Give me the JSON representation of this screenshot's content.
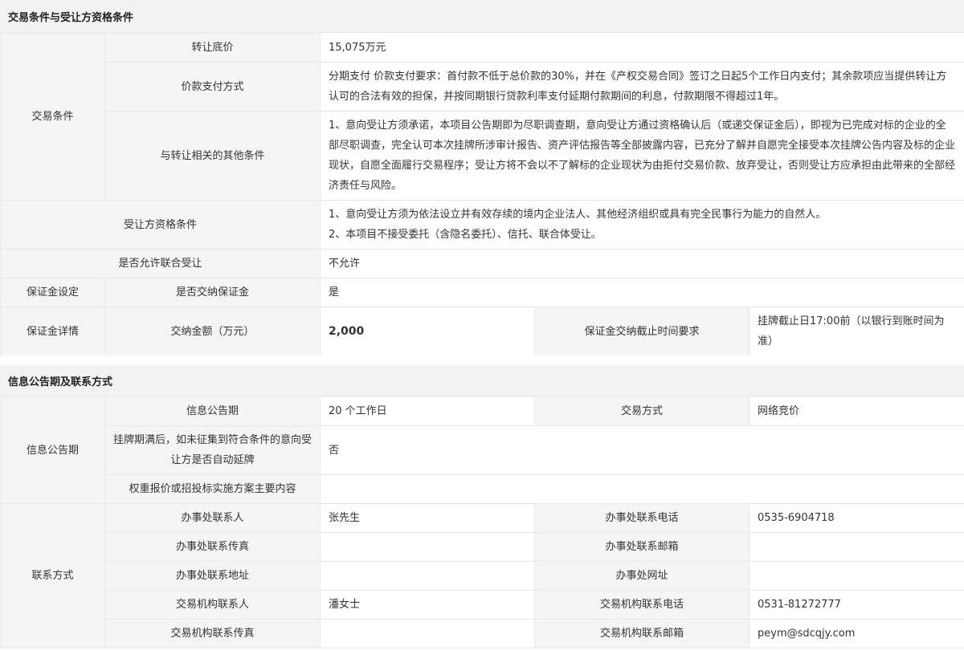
{
  "section1": {
    "title": "交易条件与受让方资格条件",
    "trade_conditions_label": "交易条件",
    "transfer_price_label": "转让底价",
    "transfer_price_value": "15,075万元",
    "payment_method_label": "价款支付方式",
    "payment_method_value": "分期支付 价款支付要求：首付款不低于总价款的30%，并在《产权交易合同》签订之日起5个工作日内支付；其余款项应当提供转让方认可的合法有效的担保，并按同期银行贷款利率支付延期付款期间的利息，付款期限不得超过1年。",
    "other_conditions_label": "与转让相关的其他条件",
    "other_conditions_value": "1、意向受让方须承诺，本项目公告期即为尽职调查期，意向受让方通过资格确认后（或递交保证金后），即视为已完成对标的企业的全部尽职调查，完全认可本次挂牌所涉审计报告、资产评估报告等全部披露内容，已充分了解并自愿完全接受本次挂牌公告内容及标的企业现状，自愿全面履行交易程序；受让方将不会以不了解标的企业现状为由拒付交易价款、放弃受让，否则受让方应承担由此带来的全部经济责任与风险。",
    "qualification_label": "受让方资格条件",
    "qualification_line1": "1、意向受让方须为依法设立并有效存续的境内企业法人、其他经济组织或具有完全民事行为能力的自然人。",
    "qualification_line2": "2、本项目不接受委托（含隐名委托）、信托、联合体受让。",
    "joint_label": "是否允许联合受让",
    "joint_value": "不允许",
    "deposit_setting_label": "保证金设定",
    "deposit_required_label": "是否交纳保证金",
    "deposit_required_value": "是",
    "deposit_detail_label": "保证金详情",
    "deposit_amount_label": "交纳金额（万元）",
    "deposit_amount_value": "2,000",
    "deposit_deadline_label": "保证金交纳截止时间要求",
    "deposit_deadline_value": "挂牌截止日17:00前（以银行到账时间为准）"
  },
  "section2": {
    "title": "信息公告期及联系方式",
    "announcement_group_label": "信息公告期",
    "announcement_period_label": "信息公告期",
    "announcement_period_value": "20 个工作日",
    "trade_method_label": "交易方式",
    "trade_method_value": "网络竞价",
    "auto_extend_label": "挂牌期满后，如未征集到符合条件的意向受让方是否自动延牌",
    "auto_extend_value": "否",
    "weighted_label": "权重报价或招投标实施方案主要内容",
    "weighted_value": "",
    "contact_group_label": "联系方式",
    "office_contact_label": "办事处联系人",
    "office_contact_value": "张先生",
    "office_phone_label": "办事处联系电话",
    "office_phone_value": "0535-6904718",
    "office_fax_label": "办事处联系传真",
    "office_fax_value": "",
    "office_email_label": "办事处联系邮箱",
    "office_email_value": "",
    "office_address_label": "办事处联系地址",
    "office_address_value": "",
    "office_website_label": "办事处网址",
    "office_website_value": "",
    "agency_contact_label": "交易机构联系人",
    "agency_contact_value": "潘女士",
    "agency_phone_label": "交易机构联系电话",
    "agency_phone_value": "0531-81272777",
    "agency_fax_label": "交易机构联系传真",
    "agency_fax_value": "",
    "agency_email_label": "交易机构联系邮箱",
    "agency_email_value": "peym@sdcqjy.com"
  }
}
